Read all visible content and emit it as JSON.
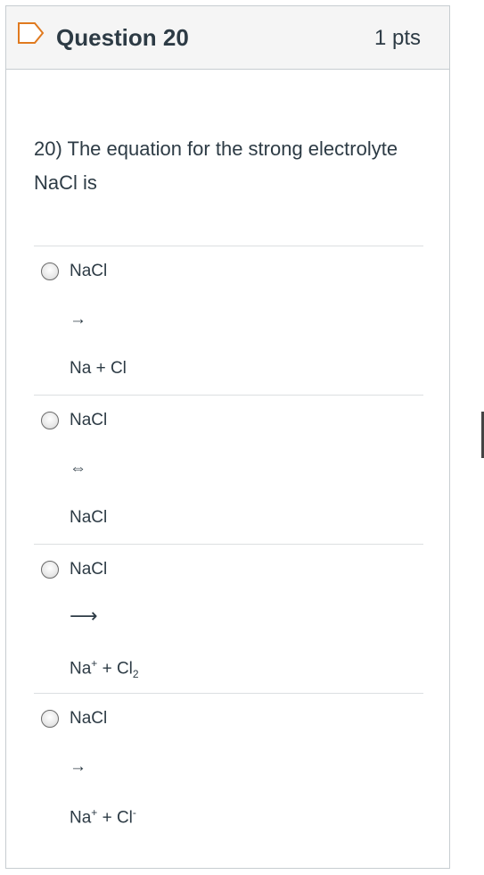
{
  "question": {
    "title": "Question 20",
    "points": "1 pts",
    "text": "20) The equation for the strong electrolyte NaCl is"
  },
  "answers": [
    {
      "reactant": "NaCl",
      "arrow": "→",
      "product_main": "Na + Cl",
      "product_sup1": "",
      "product_mid": "",
      "product_sub": "",
      "product_sup2": ""
    },
    {
      "reactant": "NaCl",
      "arrow": "⇔",
      "product_main": "NaCl",
      "product_sup1": "",
      "product_mid": "",
      "product_sub": "",
      "product_sup2": ""
    },
    {
      "reactant": "NaCl",
      "arrow": "⟶",
      "product_main": "Na",
      "product_sup1": "+",
      "product_mid": " + Cl",
      "product_sub": "2",
      "product_sup2": ""
    },
    {
      "reactant": "NaCl",
      "arrow": "→",
      "product_main": "Na",
      "product_sup1": "+",
      "product_mid": " + Cl",
      "product_sub": "",
      "product_sup2": "-"
    }
  ],
  "icons": {
    "flag": "bookmark-flag-icon",
    "radio": "radio-button-icon"
  },
  "colors": {
    "text": "#2d3b45",
    "header_bg": "#f5f5f5",
    "border": "#c7cdd1"
  }
}
